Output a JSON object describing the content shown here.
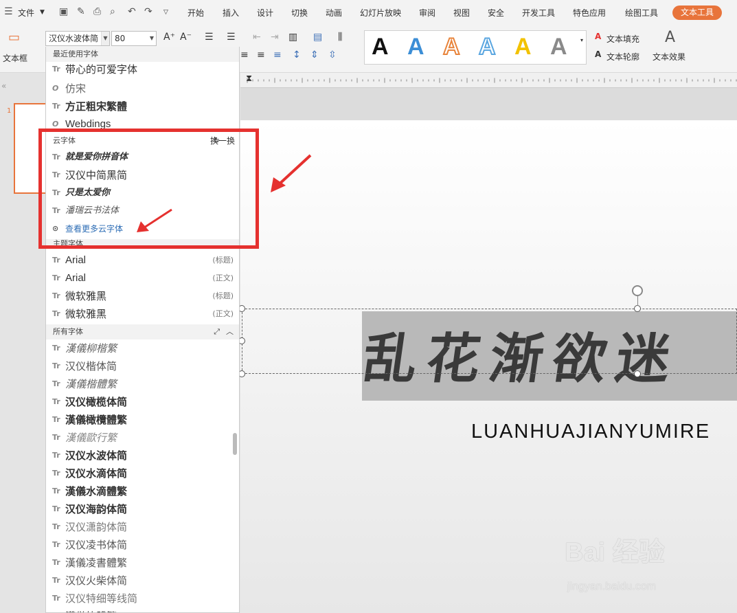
{
  "menu": {
    "file_label": "文件",
    "tabs": [
      "开始",
      "插入",
      "设计",
      "切换",
      "动画",
      "幻灯片放映",
      "审阅",
      "视图",
      "安全",
      "开发工具",
      "特色应用",
      "绘图工具"
    ],
    "active_tab": "文本工具"
  },
  "ribbon": {
    "textbox_label": "文本框",
    "font_name": "汉仪水波体简",
    "font_size": "80",
    "text_fill": "文本填充",
    "text_outline": "文本轮廓",
    "text_effect": "文本效果",
    "wordart_letter": "A",
    "wordart_colors": [
      "#111111",
      "#3c8ed6",
      "#e8843b",
      "#5aa6e0",
      "#f2c200",
      "#8a8a8a"
    ]
  },
  "dropdown": {
    "recent_header": "最近使用字体",
    "recent": [
      {
        "icon": "Tr",
        "name": "带心的可爱字体"
      },
      {
        "icon": "O",
        "name": "仿宋"
      },
      {
        "icon": "Tr",
        "name": "方正粗宋繁體"
      },
      {
        "icon": "O",
        "name": "Webdings"
      }
    ],
    "cloud_header": "云字体",
    "refresh_label": "换一换",
    "cloud": [
      {
        "icon": "Tr",
        "name": "就是爱你拼音体"
      },
      {
        "icon": "Tr",
        "name": "汉仪中简黑简"
      },
      {
        "icon": "Tr",
        "name": "只是太爱你"
      },
      {
        "icon": "Tr",
        "name": "潘瑞云书法体"
      }
    ],
    "more_cloud": "查看更多云字体",
    "theme_header": "主题字体",
    "theme": [
      {
        "icon": "Tr",
        "name": "Arial",
        "tag": "(标题)"
      },
      {
        "icon": "Tr",
        "name": "Arial",
        "tag": "(正文)"
      },
      {
        "icon": "Tr",
        "name": "微软雅黑",
        "tag": "(标题)"
      },
      {
        "icon": "Tr",
        "name": "微软雅黑",
        "tag": "(正文)"
      }
    ],
    "all_header": "所有字体",
    "all": [
      "漢儀柳楷繁",
      "汉仪楷体简",
      "漢儀楷體繁",
      "汉仪橄榄体简",
      "漢儀橄欖體繁",
      "漢儀歐行繁",
      "汉仪水波体简",
      "汉仪水滴体简",
      "漢儀水滴體繁",
      "汉仪海韵体简",
      "汉仪潇韵体简",
      "汉仪凌书体简",
      "漢儀凌書體繁",
      "汉仪火柴体简",
      "汉仪特细等线简",
      "漢儀竹體繁"
    ]
  },
  "slide": {
    "number": "1",
    "title": "乱花渐欲迷",
    "subtitle": "LUANHUAJIANYUMIRE"
  },
  "watermark": {
    "brand": "Bai 经验",
    "url": "jingyan.baidu.com"
  }
}
